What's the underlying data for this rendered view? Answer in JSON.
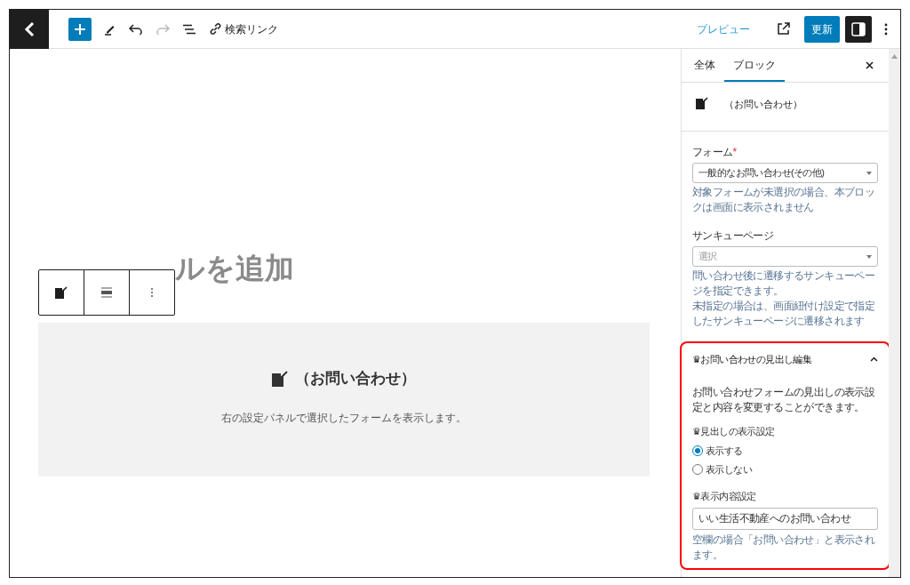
{
  "toolbar": {
    "link_label": "検索リンク",
    "preview": "プレビュー",
    "update": "更新",
    "settings_open": true
  },
  "editor": {
    "title": "ルを追加",
    "block": {
      "heading": "（お問い合わせ）",
      "description": "右の設定パネルで選択したフォームを表示します。"
    }
  },
  "sidebar": {
    "tabs": [
      {
        "label": "全体",
        "selected": false
      },
      {
        "label": "ブロック",
        "selected": true
      }
    ],
    "block_card": {
      "name": "（お問い合わせ）"
    },
    "fields": [
      {
        "label": "フォーム",
        "required_mark": "*",
        "value": "一般的なお問い合わせ(その他)",
        "help": [
          "対象フォームが未選択の場合、本ブロックは画面に表示されません"
        ]
      },
      {
        "label": "サンキューページ",
        "placeholder": "選択",
        "help": [
          "問い合わせ後に遷移するサンキューページを指定できます。",
          "未指定の場合は、画面紐付け設定で指定したサンキューページに遷移されます"
        ]
      }
    ],
    "heading_panel": {
      "title": "♛お問い合わせの見出し編集",
      "expanded": true,
      "highlighted": true,
      "description": "お問い合わせフォームの見出しの表示設定と内容を変更することができます。",
      "display_label": "♛見出しの表示設定",
      "options": [
        {
          "label": "表示する",
          "selected": true
        },
        {
          "label": "表示しない",
          "selected": false
        }
      ],
      "content_label": "♛表示内容設定",
      "content_value": "いい生活不動産へのお問い合わせ",
      "content_help": "空欄の場合「お問い合わせ」と表示されます。"
    }
  }
}
